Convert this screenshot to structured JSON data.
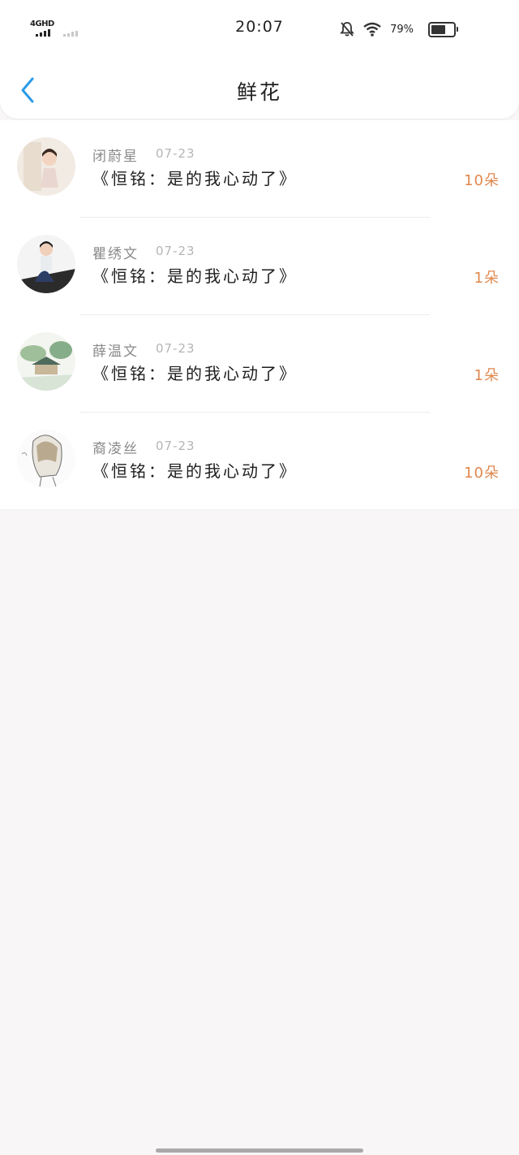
{
  "status_bar": {
    "network": "4GHD",
    "time": "20:07",
    "battery_pct": "79%",
    "battery_level": 0.79,
    "icons": [
      "signal-icon",
      "bell-off-icon",
      "wifi-icon",
      "battery-icon"
    ]
  },
  "header": {
    "title": "鲜花",
    "back_icon": "chevron-left-icon",
    "accent": "#2b9ae8"
  },
  "items": [
    {
      "name": "闭蔚星",
      "date": "07-23",
      "message": "《恒铭：是的我心动了》",
      "count": "10朵",
      "avatar": "avatar-icon"
    },
    {
      "name": "瞿绣文",
      "date": "07-23",
      "message": "《恒铭：是的我心动了》",
      "count": "1朵",
      "avatar": "avatar-icon"
    },
    {
      "name": "薛温文",
      "date": "07-23",
      "message": "《恒铭：是的我心动了》",
      "count": "1朵",
      "avatar": "avatar-icon"
    },
    {
      "name": "裔凌丝",
      "date": "07-23",
      "message": "《恒铭：是的我心动了》",
      "count": "10朵",
      "avatar": "avatar-icon"
    }
  ],
  "colors": {
    "count": "#e0884e",
    "name": "#8a8a8a",
    "date": "#b5b5b5",
    "background": "#f8f6f7"
  }
}
